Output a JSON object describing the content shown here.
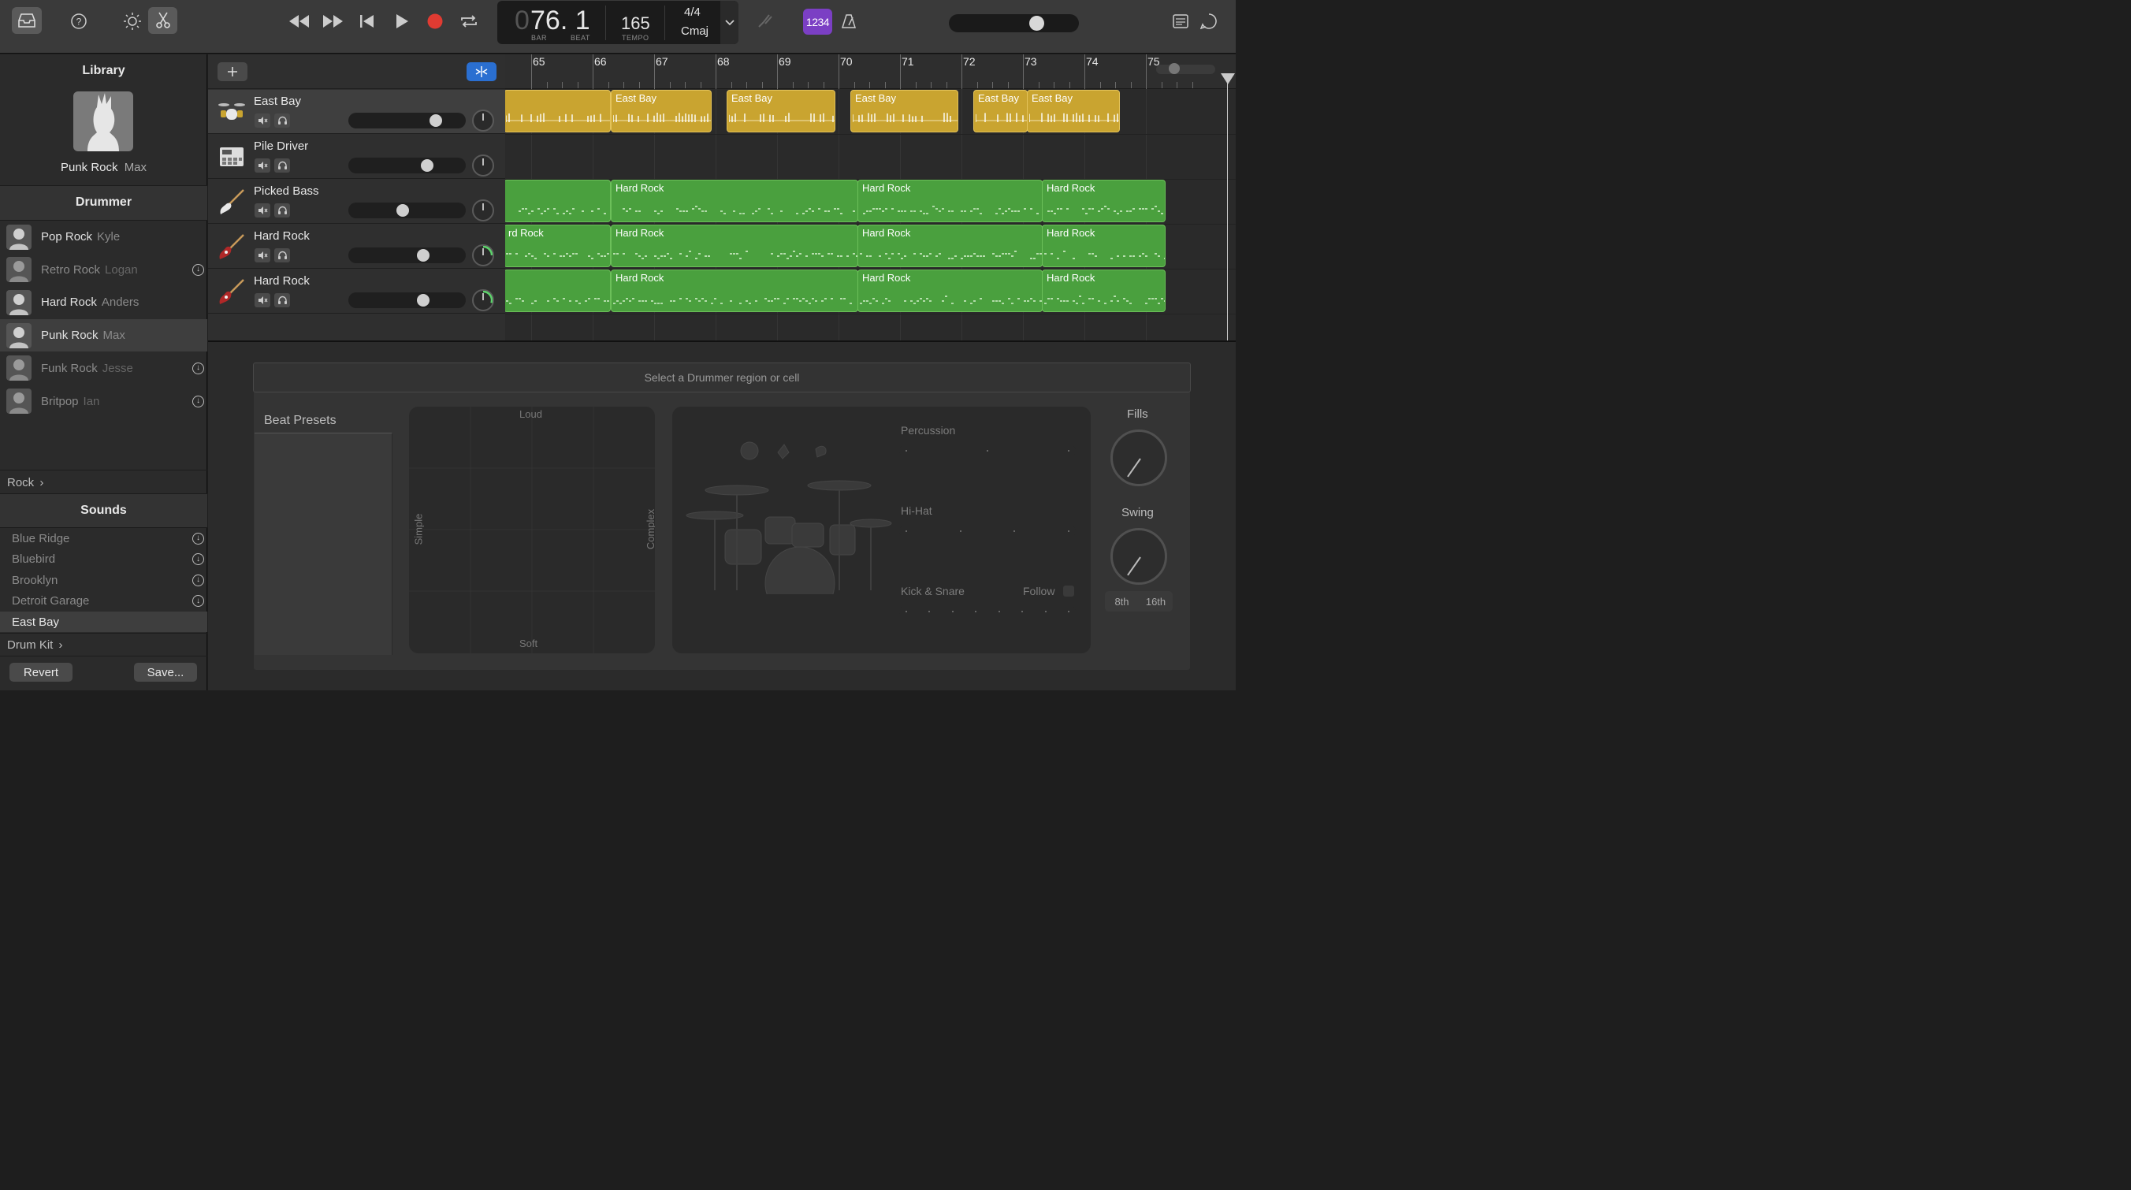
{
  "toolbar": {
    "lcd": {
      "position_prefix": "0",
      "position_main": "76. 1",
      "bar_label": "BAR",
      "beat_label": "BEAT",
      "tempo": "165",
      "tempo_label": "TEMPO",
      "signature": "4/4",
      "key": "Cmaj"
    },
    "count_in_label": "1234"
  },
  "library": {
    "title": "Library",
    "patch_name": "Punk Rock",
    "patch_drummer": "Max",
    "drummer_header": "Drummer",
    "drummers": [
      {
        "style": "Pop Rock",
        "name": "Kyle",
        "dim": false,
        "download": false,
        "selected": false
      },
      {
        "style": "Retro Rock",
        "name": "Logan",
        "dim": true,
        "download": true,
        "selected": false
      },
      {
        "style": "Hard Rock",
        "name": "Anders",
        "dim": false,
        "download": false,
        "selected": false
      },
      {
        "style": "Punk Rock",
        "name": "Max",
        "dim": false,
        "download": false,
        "selected": true
      },
      {
        "style": "Funk Rock",
        "name": "Jesse",
        "dim": true,
        "download": true,
        "selected": false
      },
      {
        "style": "Britpop",
        "name": "Ian",
        "dim": true,
        "download": true,
        "selected": false
      }
    ],
    "genre": "Rock",
    "sounds_header": "Sounds",
    "sounds": [
      {
        "name": "Blue Ridge",
        "download": true,
        "selected": false
      },
      {
        "name": "Bluebird",
        "download": true,
        "selected": false
      },
      {
        "name": "Brooklyn",
        "download": true,
        "selected": false
      },
      {
        "name": "Detroit Garage",
        "download": true,
        "selected": false
      },
      {
        "name": "East Bay",
        "download": false,
        "selected": true
      }
    ],
    "kit_category": "Drum Kit",
    "revert_label": "Revert",
    "save_label": "Save..."
  },
  "tracks": [
    {
      "name": "East Bay",
      "icon": "drum-kit-icon",
      "selected": true,
      "volume": 0.78,
      "pan_level": 0
    },
    {
      "name": "Pile Driver",
      "icon": "drum-machine-icon",
      "selected": false,
      "volume": 0.7,
      "pan_level": 0
    },
    {
      "name": "Picked Bass",
      "icon": "bass-guitar-icon",
      "selected": false,
      "volume": 0.46,
      "pan_level": 0
    },
    {
      "name": "Hard Rock",
      "icon": "electric-guitar-icon",
      "selected": false,
      "volume": 0.66,
      "pan_level": 0.25
    },
    {
      "name": "Hard Rock",
      "icon": "electric-guitar-icon",
      "selected": false,
      "volume": 0.66,
      "pan_level": 0.3
    }
  ],
  "ruler": {
    "bars": [
      "65",
      "66",
      "67",
      "68",
      "69",
      "70",
      "71",
      "72",
      "73",
      "74",
      "75"
    ]
  },
  "regions": {
    "east_bay_label": "East Bay",
    "hard_rock_label": "Hard Rock",
    "partial_hard_rock_label": "rd Rock"
  },
  "editor": {
    "hint": "Select a Drummer region or cell",
    "beat_presets": "Beat Presets",
    "xy_pad": {
      "top": "Loud",
      "bottom": "Soft",
      "left": "Simple",
      "right": "Complex"
    },
    "percussion": "Percussion",
    "hihat": "Hi-Hat",
    "kick_snare": "Kick & Snare",
    "follow": "Follow",
    "fills": "Fills",
    "swing": "Swing",
    "eighth": "8th",
    "sixteenth": "16th"
  },
  "colors": {
    "drummer_region": "#c9a430",
    "midi_region": "#4aa03e",
    "record": "#e03b32",
    "count_in": "#7b3fc4",
    "accent_blue": "#2a6fd1"
  }
}
